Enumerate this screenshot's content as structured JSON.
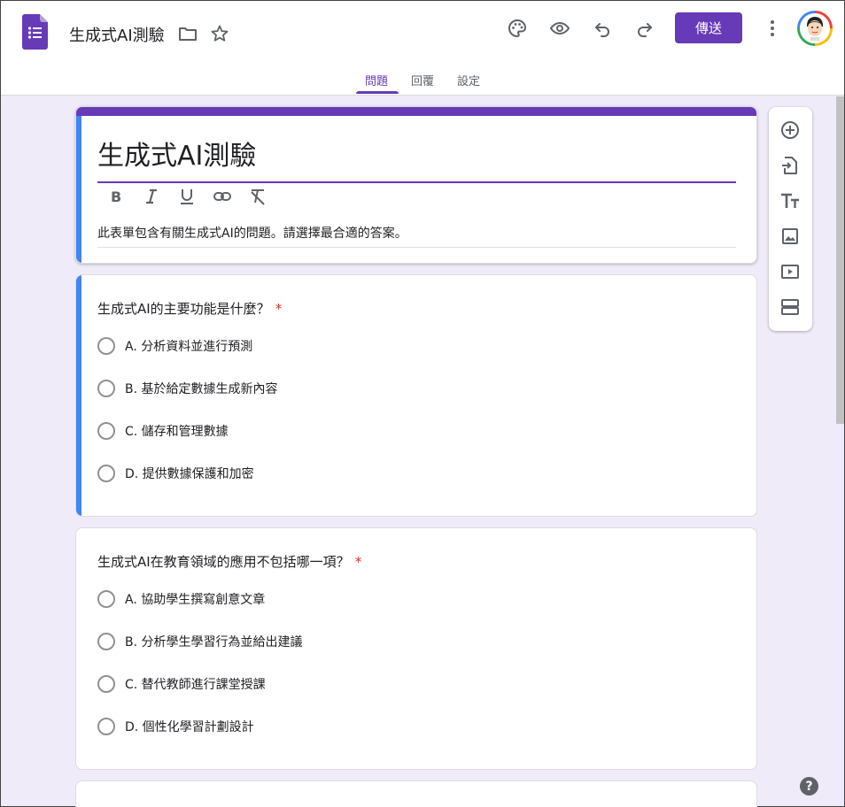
{
  "app": {
    "doc_title": "生成式AI測驗",
    "send_label": "傳送",
    "accent_color": "#673ab7"
  },
  "tabs": [
    {
      "label": "問題",
      "active": true
    },
    {
      "label": "回覆",
      "active": false
    },
    {
      "label": "設定",
      "active": false
    }
  ],
  "toolbar_icons": [
    "palette-icon",
    "preview-eye-icon",
    "undo-icon",
    "redo-icon",
    "more-vert-icon"
  ],
  "form": {
    "title": "生成式AI測驗",
    "description": "此表單包含有關生成式AI的問題。請選擇最合適的答案。"
  },
  "questions": [
    {
      "text": "生成式AI的主要功能是什麼？",
      "required_mark": "*",
      "options": [
        "A. 分析資料並進行預測",
        "B. 基於給定數據生成新內容",
        "C. 儲存和管理數據",
        "D. 提供數據保護和加密"
      ]
    },
    {
      "text": "生成式AI在教育領域的應用不包括哪一項？",
      "required_mark": "*",
      "options": [
        "A. 協助學生撰寫創意文章",
        "B. 分析學生學習行為並給出建議",
        "C. 替代教師進行課堂授課",
        "D. 個性化學習計劃設計"
      ]
    }
  ],
  "side_toolbar": [
    "add-question-icon",
    "import-question-icon",
    "add-title-icon",
    "add-image-icon",
    "add-video-icon",
    "add-section-icon"
  ],
  "help_label": "?"
}
